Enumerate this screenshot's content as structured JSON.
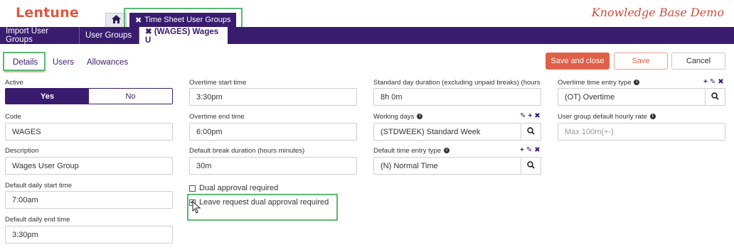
{
  "app": {
    "logo": "Lentune",
    "kb_title": "Knowledge Base Demo"
  },
  "top_tabs": {
    "home_icon": "home-icon",
    "tsg_close": "✖",
    "tsg_label": "Time Sheet User Groups"
  },
  "nav": {
    "items": [
      {
        "label": "Import User Groups"
      },
      {
        "label": "User Groups"
      },
      {
        "label": "✖ (WAGES) Wages U"
      }
    ]
  },
  "subtabs": [
    {
      "label": "Details"
    },
    {
      "label": "Users"
    },
    {
      "label": "Allowances"
    }
  ],
  "actions": {
    "save_close": "Save and close",
    "save": "Save",
    "cancel": "Cancel"
  },
  "col1": {
    "active_label": "Active",
    "yes": "Yes",
    "no": "No",
    "code_label": "Code",
    "code_value": "WAGES",
    "desc_label": "Description",
    "desc_value": "Wages User Group",
    "start_label": "Default daily start time",
    "start_value": "7:00am",
    "end_label": "Default daily end time",
    "end_value": "3:30pm"
  },
  "col2": {
    "ot_start_label": "Overtime start time",
    "ot_start_value": "3:30pm",
    "ot_end_label": "Overtime end time",
    "ot_end_value": "6:00pm",
    "break_label": "Default break duration (hours minutes)",
    "break_value": "30m",
    "dual_label": "Dual approval required",
    "leave_label": "Leave request dual approval required"
  },
  "col3": {
    "std_label": "Standard day duration (excluding unpaid breaks) (hours ...",
    "std_value": "8h 0m",
    "wd_label": "Working days",
    "wd_value": "(STDWEEK) Standard Week",
    "te_label": "Default time entry type",
    "te_value": "(N) Normal Time"
  },
  "col4": {
    "ot_type_label": "Overtime time entry type",
    "ot_type_value": "(OT) Overtime",
    "rate_label": "User group default hourly rate",
    "rate_placeholder": "Max 100m(+-)"
  },
  "colors": {
    "brand": "#3a1c6e",
    "accent": "#df6048",
    "highlight": "#5cb874"
  }
}
